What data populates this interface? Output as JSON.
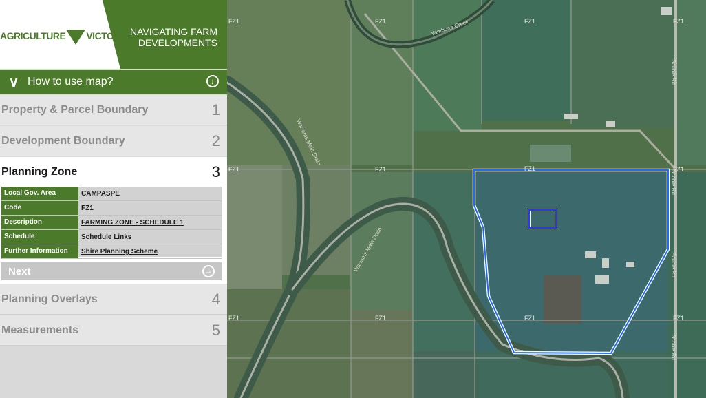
{
  "header": {
    "logo_left": "AGRICULTURE",
    "logo_right": "VICTORIA",
    "title_line1": "NAVIGATING FARM",
    "title_line2": "DEVELOPMENTS"
  },
  "how_to": {
    "label": "How to use map?"
  },
  "steps": [
    {
      "label": "Property & Parcel Boundary",
      "number": "1"
    },
    {
      "label": "Development Boundary",
      "number": "2"
    },
    {
      "label": "Planning Zone",
      "number": "3"
    },
    {
      "label": "Planning Overlays",
      "number": "4"
    },
    {
      "label": "Measurements",
      "number": "5"
    }
  ],
  "planning_zone": {
    "rows": [
      {
        "key": "Local Gov. Area",
        "value": "CAMPASPE"
      },
      {
        "key": "Code",
        "value": "FZ1"
      },
      {
        "key": "Description",
        "value": "FARMING ZONE - SCHEDULE 1"
      },
      {
        "key": "Schedule",
        "value": "Schedule Links"
      },
      {
        "key": "Further Information",
        "value": "Shire Planning Scheme"
      }
    ]
  },
  "next": {
    "label": "Next"
  },
  "map": {
    "zone_label": "FZ1",
    "roads": [
      "Yambuna Creek",
      "Warrams Main Drain",
      "Scobie Rd"
    ]
  },
  "colors": {
    "brand_green": "#4b7a2a",
    "boundary_blue": "#1e6cff"
  }
}
